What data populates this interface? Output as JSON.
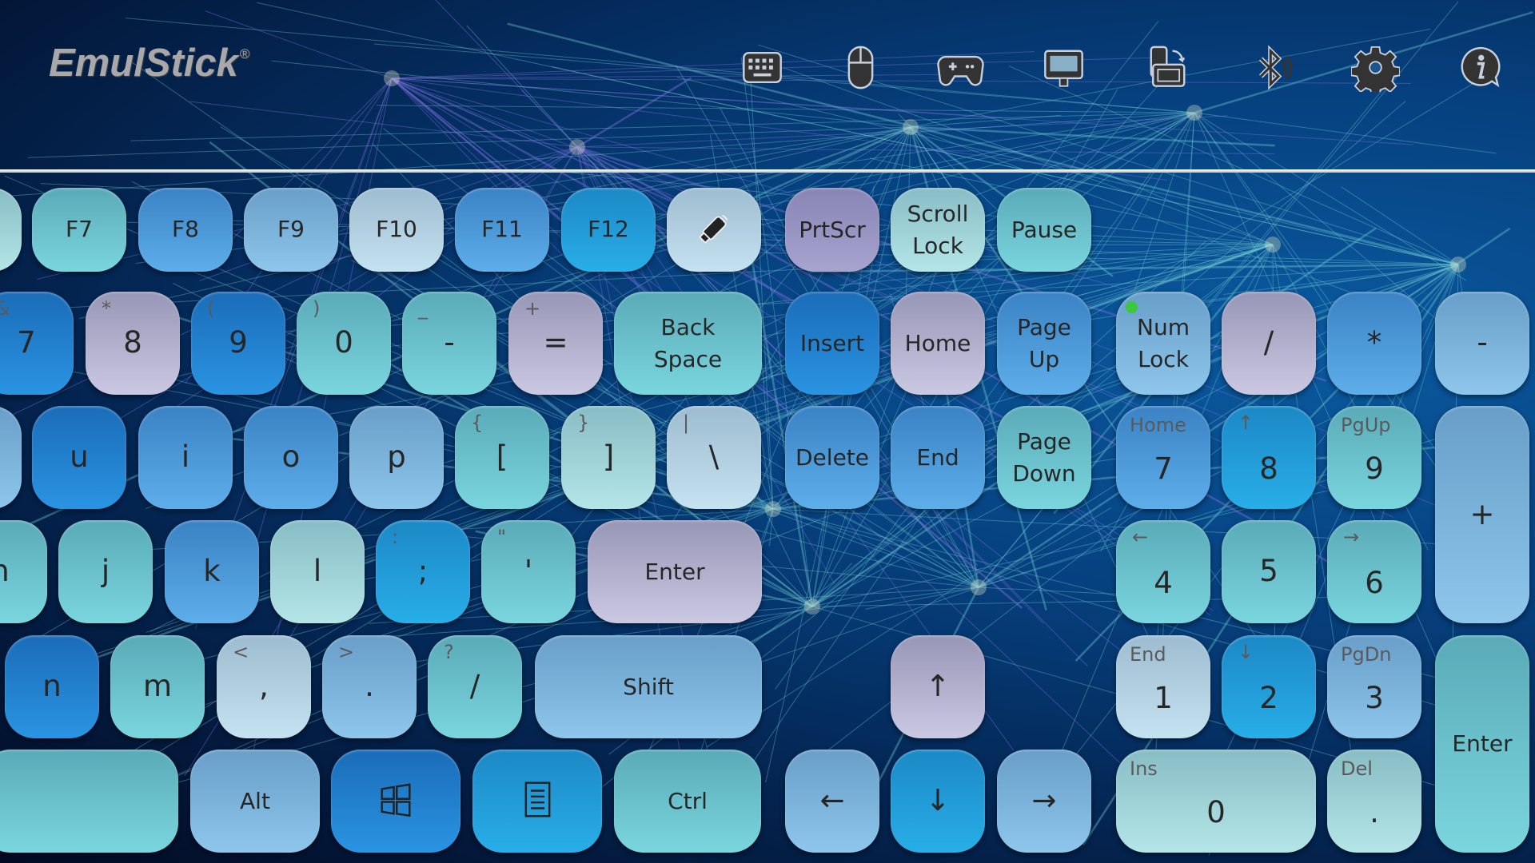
{
  "app": {
    "logo": "EmulStick",
    "logo_mark": "®"
  },
  "toolbar": [
    {
      "name": "keyboard-icon"
    },
    {
      "name": "mouse-icon"
    },
    {
      "name": "gamepad-icon"
    },
    {
      "name": "monitor-icon"
    },
    {
      "name": "rotate-device-icon"
    },
    {
      "name": "bluetooth-icon"
    },
    {
      "name": "gear-icon"
    },
    {
      "name": "info-icon"
    }
  ],
  "colors": {
    "teal": "#6cc4cc",
    "blue": "#4a98d8",
    "light": "#b0d0e0",
    "lavender": "#b0aecc",
    "cyan": "#22a0dc",
    "deep": "#2080cc",
    "sky": "#7cb4dc",
    "mint": "#a0d4d8",
    "led": "#3cc83c"
  },
  "keys": [
    {
      "id": "f6",
      "label": "",
      "sub": "",
      "color": "M"
    },
    {
      "id": "f7",
      "label": "F7",
      "sub": "",
      "color": "T"
    },
    {
      "id": "f8",
      "label": "F8",
      "sub": "",
      "color": "B"
    },
    {
      "id": "f9",
      "label": "F9",
      "sub": "",
      "color": "S"
    },
    {
      "id": "f10",
      "label": "F10",
      "sub": "",
      "color": "L"
    },
    {
      "id": "f11",
      "label": "F11",
      "sub": "",
      "color": "B"
    },
    {
      "id": "f12",
      "label": "F12",
      "sub": "",
      "color": "C"
    },
    {
      "id": "emulstick",
      "label": "",
      "sub": "",
      "color": "L",
      "icon": "usb-dongle-icon"
    },
    {
      "id": "prtscr",
      "label": "PrtScr",
      "sub": "",
      "color": "P"
    },
    {
      "id": "scrolllock",
      "label": "Scroll Lock",
      "sub": "",
      "color": "M"
    },
    {
      "id": "pause",
      "label": "Pause",
      "sub": "",
      "color": "T"
    },
    {
      "id": "7",
      "label": "7",
      "sub": "&",
      "color": "D"
    },
    {
      "id": "8",
      "label": "8",
      "sub": "*",
      "color": "V"
    },
    {
      "id": "9",
      "label": "9",
      "sub": "(",
      "color": "D"
    },
    {
      "id": "0",
      "label": "0",
      "sub": ")",
      "color": "T"
    },
    {
      "id": "minus",
      "label": "-",
      "sub": "_",
      "color": "T"
    },
    {
      "id": "equal",
      "label": "=",
      "sub": "+",
      "color": "V"
    },
    {
      "id": "backspace",
      "label": "Back Space",
      "sub": "",
      "color": "T"
    },
    {
      "id": "insert",
      "label": "Insert",
      "sub": "",
      "color": "D"
    },
    {
      "id": "home",
      "label": "Home",
      "sub": "",
      "color": "V"
    },
    {
      "id": "pageup",
      "label": "Page Up",
      "sub": "",
      "color": "B"
    },
    {
      "id": "numlock",
      "label": "Num Lock",
      "sub": "",
      "color": "S",
      "led": true
    },
    {
      "id": "np-divide",
      "label": "/",
      "sub": "",
      "color": "V"
    },
    {
      "id": "np-multiply",
      "label": "*",
      "sub": "",
      "color": "B"
    },
    {
      "id": "np-subtract",
      "label": "-",
      "sub": "",
      "color": "S"
    },
    {
      "id": "y",
      "label": "",
      "sub": "",
      "color": "S"
    },
    {
      "id": "u",
      "label": "u",
      "sub": "",
      "color": "D"
    },
    {
      "id": "i",
      "label": "i",
      "sub": "",
      "color": "B"
    },
    {
      "id": "o",
      "label": "o",
      "sub": "",
      "color": "B"
    },
    {
      "id": "p",
      "label": "p",
      "sub": "",
      "color": "S"
    },
    {
      "id": "lbracket",
      "label": "[",
      "sub": "{",
      "color": "T"
    },
    {
      "id": "rbracket",
      "label": "]",
      "sub": "}",
      "color": "M"
    },
    {
      "id": "backslash",
      "label": "\\",
      "sub": "|",
      "color": "L"
    },
    {
      "id": "delete",
      "label": "Delete",
      "sub": "",
      "color": "B"
    },
    {
      "id": "end",
      "label": "End",
      "sub": "",
      "color": "B"
    },
    {
      "id": "pagedown",
      "label": "Page Down",
      "sub": "",
      "color": "T"
    },
    {
      "id": "np-7",
      "label": "7",
      "sub": "Home",
      "color": "B"
    },
    {
      "id": "np-8",
      "label": "8",
      "sub": "↑",
      "color": "C"
    },
    {
      "id": "np-9",
      "label": "9",
      "sub": "PgUp",
      "color": "T"
    },
    {
      "id": "np-add",
      "label": "+",
      "sub": "",
      "color": "S"
    },
    {
      "id": "h",
      "label": "h",
      "sub": "",
      "color": "T"
    },
    {
      "id": "j",
      "label": "j",
      "sub": "",
      "color": "T"
    },
    {
      "id": "k",
      "label": "k",
      "sub": "",
      "color": "B"
    },
    {
      "id": "l",
      "label": "l",
      "sub": "",
      "color": "M"
    },
    {
      "id": "semicolon",
      "label": ";",
      "sub": ":",
      "color": "C"
    },
    {
      "id": "quote",
      "label": "'",
      "sub": "\"",
      "color": "T"
    },
    {
      "id": "enter",
      "label": "Enter",
      "sub": "",
      "color": "V"
    },
    {
      "id": "np-4",
      "label": "4",
      "sub": "←",
      "color": "T"
    },
    {
      "id": "np-5",
      "label": "5",
      "sub": "",
      "color": "T"
    },
    {
      "id": "np-6",
      "label": "6",
      "sub": "→",
      "color": "T"
    },
    {
      "id": "n",
      "label": "n",
      "sub": "",
      "color": "D"
    },
    {
      "id": "m",
      "label": "m",
      "sub": "",
      "color": "T"
    },
    {
      "id": "comma",
      "label": ",",
      "sub": "<",
      "color": "L"
    },
    {
      "id": "period",
      "label": ".",
      "sub": ">",
      "color": "S"
    },
    {
      "id": "slash",
      "label": "/",
      "sub": "?",
      "color": "T"
    },
    {
      "id": "shift",
      "label": "Shift",
      "sub": "",
      "color": "S"
    },
    {
      "id": "arrow-up",
      "label": "↑",
      "sub": "",
      "color": "V"
    },
    {
      "id": "np-1",
      "label": "1",
      "sub": "End",
      "color": "L"
    },
    {
      "id": "np-2",
      "label": "2",
      "sub": "↓",
      "color": "C"
    },
    {
      "id": "np-3",
      "label": "3",
      "sub": "PgDn",
      "color": "S"
    },
    {
      "id": "np-enter",
      "label": "Enter",
      "sub": "",
      "color": "T"
    },
    {
      "id": "space",
      "label": "",
      "sub": "",
      "color": "T"
    },
    {
      "id": "alt",
      "label": "Alt",
      "sub": "",
      "color": "S"
    },
    {
      "id": "windows",
      "label": "",
      "sub": "",
      "color": "D",
      "icon": "windows-icon"
    },
    {
      "id": "menu",
      "label": "",
      "sub": "",
      "color": "C",
      "icon": "menu-icon"
    },
    {
      "id": "ctrl",
      "label": "Ctrl",
      "sub": "",
      "color": "T"
    },
    {
      "id": "arrow-left",
      "label": "←",
      "sub": "",
      "color": "S"
    },
    {
      "id": "arrow-down",
      "label": "↓",
      "sub": "",
      "color": "C"
    },
    {
      "id": "arrow-right",
      "label": "→",
      "sub": "",
      "color": "S"
    },
    {
      "id": "np-0",
      "label": "0",
      "sub": "Ins",
      "color": "M"
    },
    {
      "id": "np-decimal",
      "label": ".",
      "sub": "Del",
      "color": "M"
    }
  ]
}
